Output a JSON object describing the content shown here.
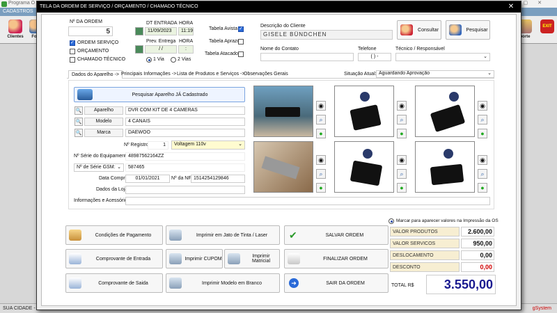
{
  "bg": {
    "app_title": "Programa O",
    "menu": "CADASTROS",
    "buttons": [
      "Clientes",
      "Forn"
    ],
    "right_buttons": [
      "porte",
      "EXIT"
    ],
    "status_left": "SUA CIDADE - S",
    "status_right": "gSystem"
  },
  "dialog": {
    "title": "TELA DA ORDEM DE SERVIÇO / ORÇAMENTO / CHAMADO TÉCNICO",
    "close": "✕"
  },
  "order": {
    "number_label": "Nº DA ORDEM",
    "number": "5",
    "types": [
      {
        "label": "ORDEM SERVIÇO",
        "checked": true
      },
      {
        "label": "ORÇAMENTO",
        "checked": false
      },
      {
        "label": "CHAMADO TÉCNICO",
        "checked": false
      }
    ],
    "dt_entrada_label": "DT ENTRADA",
    "hora_label": "HORA",
    "dt_entrada": "11/09/2023",
    "hora": "11:19",
    "prev_entrega_label": "Prev. Entrega",
    "hora2_label": "HORA",
    "prev_entrega": "  /  /",
    "hora2": ":",
    "via1": "1 Via",
    "via2": "2 Vias",
    "tabela_avista": "Tabela Avista",
    "tabela_aprazo": "Tabela Aprazo",
    "tabela_atacado": "Tabela Atacado"
  },
  "client": {
    "desc_label": "Descrição do Cliente",
    "name": "GISELE BÜNDCHEN",
    "consultar": "Consultar",
    "pesquisar": "Pesquisar",
    "contato_label": "Nome do Contato",
    "telefone_label": "Telefone",
    "telefone": "(  )    -",
    "tecnico_label": "Técnico / Responsável"
  },
  "tabs": [
    "Dados do Aparelho ->",
    "Principais Informações ->",
    "Lista de Produtos e Serviços ->",
    "Observações Gerais"
  ],
  "situacao_label": "Situação Atual:",
  "situacao": "Aguardando Aprovação",
  "device": {
    "search_btn": "Pesquisar Aparelho JÁ Cadastrado",
    "aparelho_label": "Aparelho",
    "aparelho": "DVR COM KIT DE 4 CAMERAS",
    "modelo_label": "Modelo",
    "modelo": "4 CANAIS",
    "marca_label": "Marca",
    "marca": "DAEWOO",
    "registro_label": "Nº Registro:",
    "registro": "1",
    "voltagem": "Voltagem 110v",
    "serie_label": "Nº Série do Equipamento:",
    "serie": "48987562164ZZ",
    "gsm_label": "Nº de Série GSM:",
    "gsm": "587465",
    "compra_label": "Data Compra:",
    "compra": "01/01/2021",
    "nf_label": "Nº da NF:",
    "nf": "1514254129846",
    "loja_label": "Dados da Loja:",
    "loja": "",
    "info_label": "Informações e Acessórios:"
  },
  "actions": {
    "cond_pag": "Condições de Pagamento",
    "imprimir_jato": "Imprimir em Jato de Tinta / Laser",
    "salvar": "SALVAR ORDEM",
    "comp_entrada": "Comprovante de Entrada",
    "imprimir_cupom": "Imprimir CUPOM",
    "imprimir_matricial": "Imprimir Matricial",
    "finalizar": "FINALIZAR ORDEM",
    "comp_saida": "Comprovante de Saida",
    "imprimir_branco": "Imprimir Modelo em Branco",
    "sair": "SAIR DA ORDEM"
  },
  "totals": {
    "marcar_label": "Marcar para aparecer valores na Impressão da OS",
    "rows": [
      {
        "label": "VALOR PRODUTOS",
        "value": "2.600,00"
      },
      {
        "label": "VALOR SERVICOS",
        "value": "950,00"
      },
      {
        "label": "DESLOCAMENTO",
        "value": "0,00"
      },
      {
        "label": "DESCONTO",
        "value": "0,00"
      }
    ],
    "total_label": "TOTAL R$",
    "total": "3.550,00"
  },
  "colors": {
    "accent_blue": "#1a1aa0",
    "discount_red": "#d00000",
    "total_blue": "#1a1a90"
  }
}
